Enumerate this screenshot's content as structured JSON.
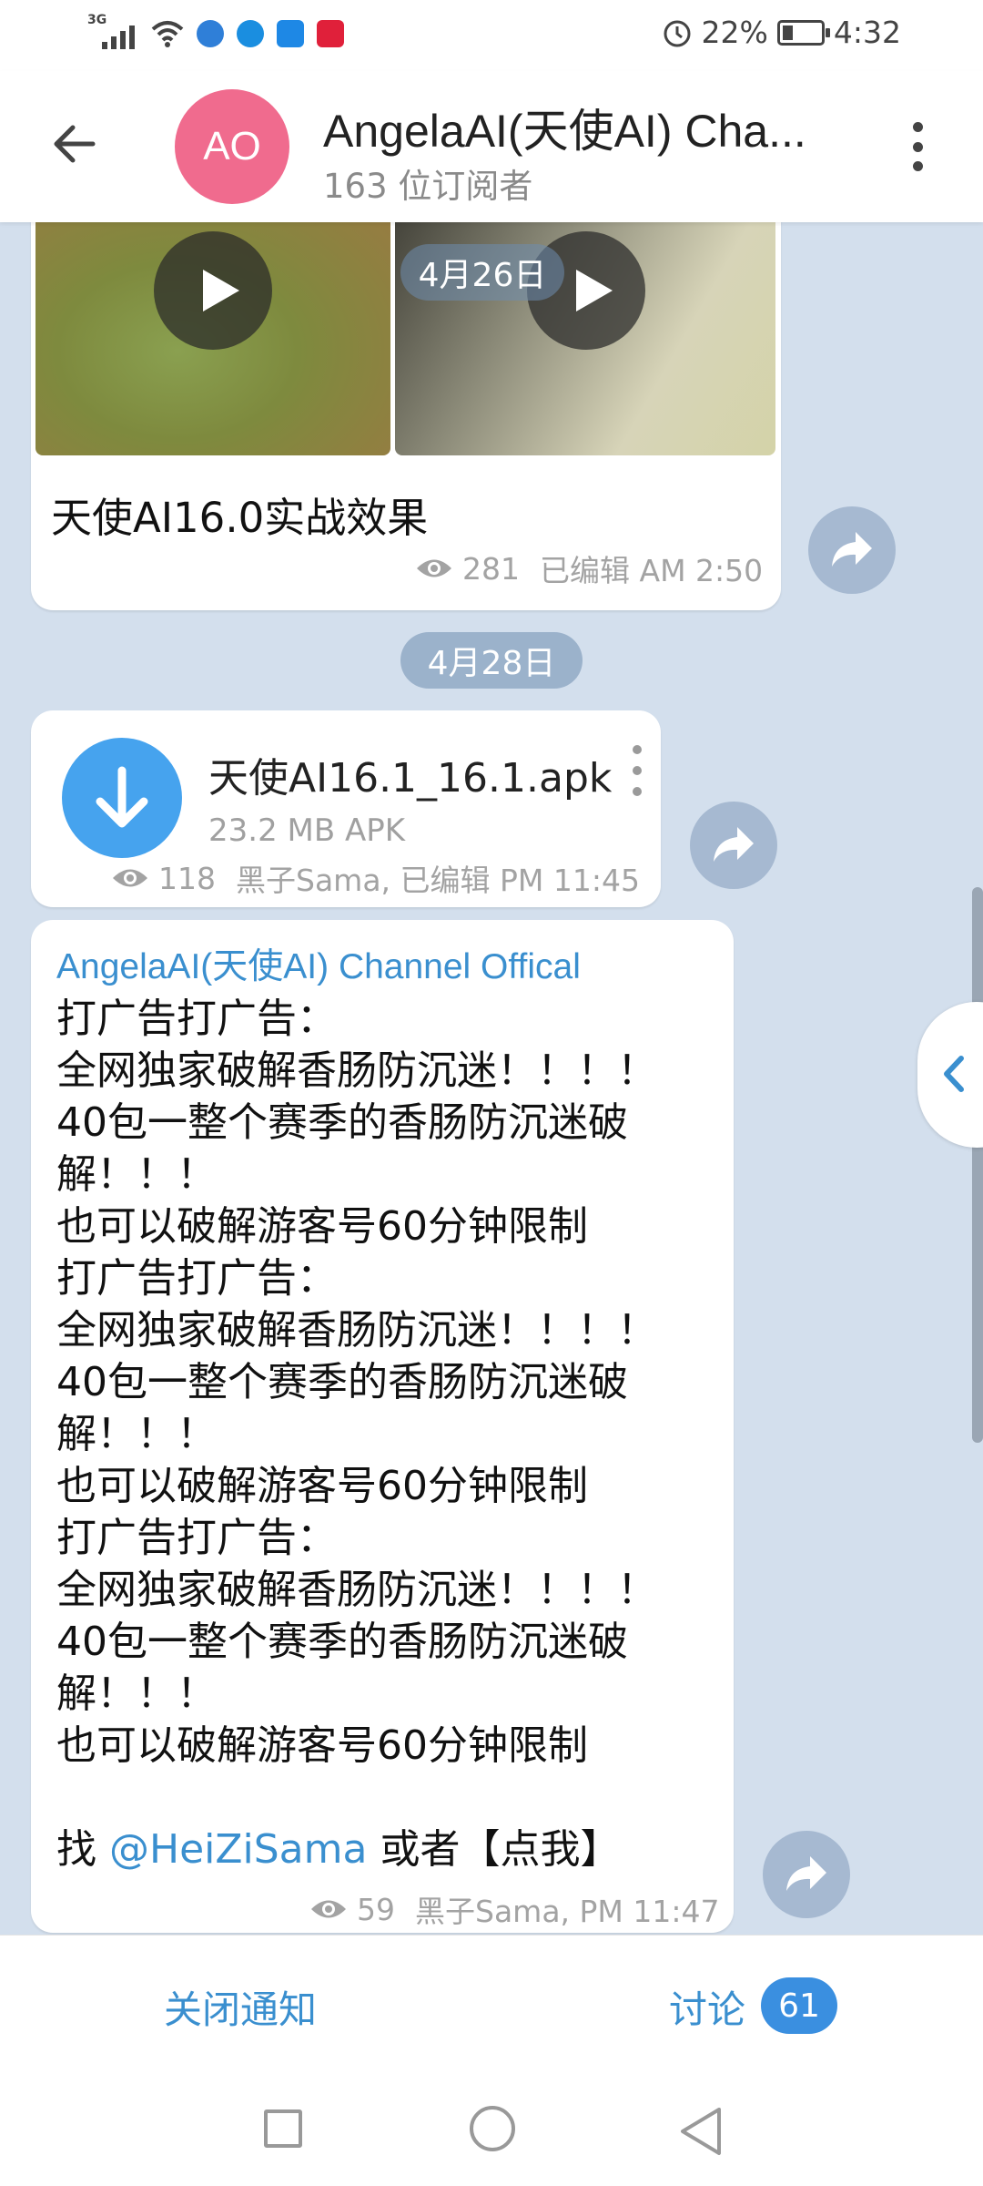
{
  "status": {
    "network": "3G",
    "battery": "22%",
    "time": "4:32"
  },
  "header": {
    "avatar_initials": "AO",
    "title": "AngelaAI(天使AI) Cha...",
    "subtitle": "163 位订阅者"
  },
  "messages": [
    {
      "date_label": "4月26日",
      "caption": "天使AI16.0实战效果",
      "views": "281",
      "meta": "已编辑 AM 2:50"
    },
    {
      "date_label": "4月28日",
      "file_name": "天使AI16.1_16.1.apk",
      "file_size": "23.2 MB APK",
      "views": "118",
      "meta": "黑子Sama, 已编辑 PM 11:45"
    },
    {
      "sender": "AngelaAI(天使AI) Channel Offical",
      "lines": [
        "打广告打广告：",
        "全网独家破解香肠防沉迷！！！！",
        "40包一整个赛季的香肠防沉迷破",
        "解！！！",
        "也可以破解游客号60分钟限制",
        "打广告打广告：",
        "全网独家破解香肠防沉迷！！！！",
        "40包一整个赛季的香肠防沉迷破",
        "解！！！",
        "也可以破解游客号60分钟限制",
        "打广告打广告：",
        "全网独家破解香肠防沉迷！！！！",
        "40包一整个赛季的香肠防沉迷破",
        "解！！！",
        "也可以破解游客号60分钟限制"
      ],
      "last_line_prefix": "找 ",
      "mention": "@HeiZiSama",
      "last_line_suffix": " 或者【点我】",
      "views": "59",
      "meta": "黑子Sama, PM 11:47"
    }
  ],
  "bottom": {
    "mute_label": "关闭通知",
    "discuss_label": "讨论",
    "discuss_count": "61"
  },
  "colors": {
    "accent": "#3a8fcf",
    "chat_bg": "#d3dfed",
    "avatar": "#f06b8e",
    "download": "#46a3ee"
  },
  "icons": [
    "back-arrow-icon",
    "more-vert-icon",
    "play-icon",
    "share-icon",
    "eye-icon",
    "download-icon",
    "chevron-left-icon"
  ]
}
